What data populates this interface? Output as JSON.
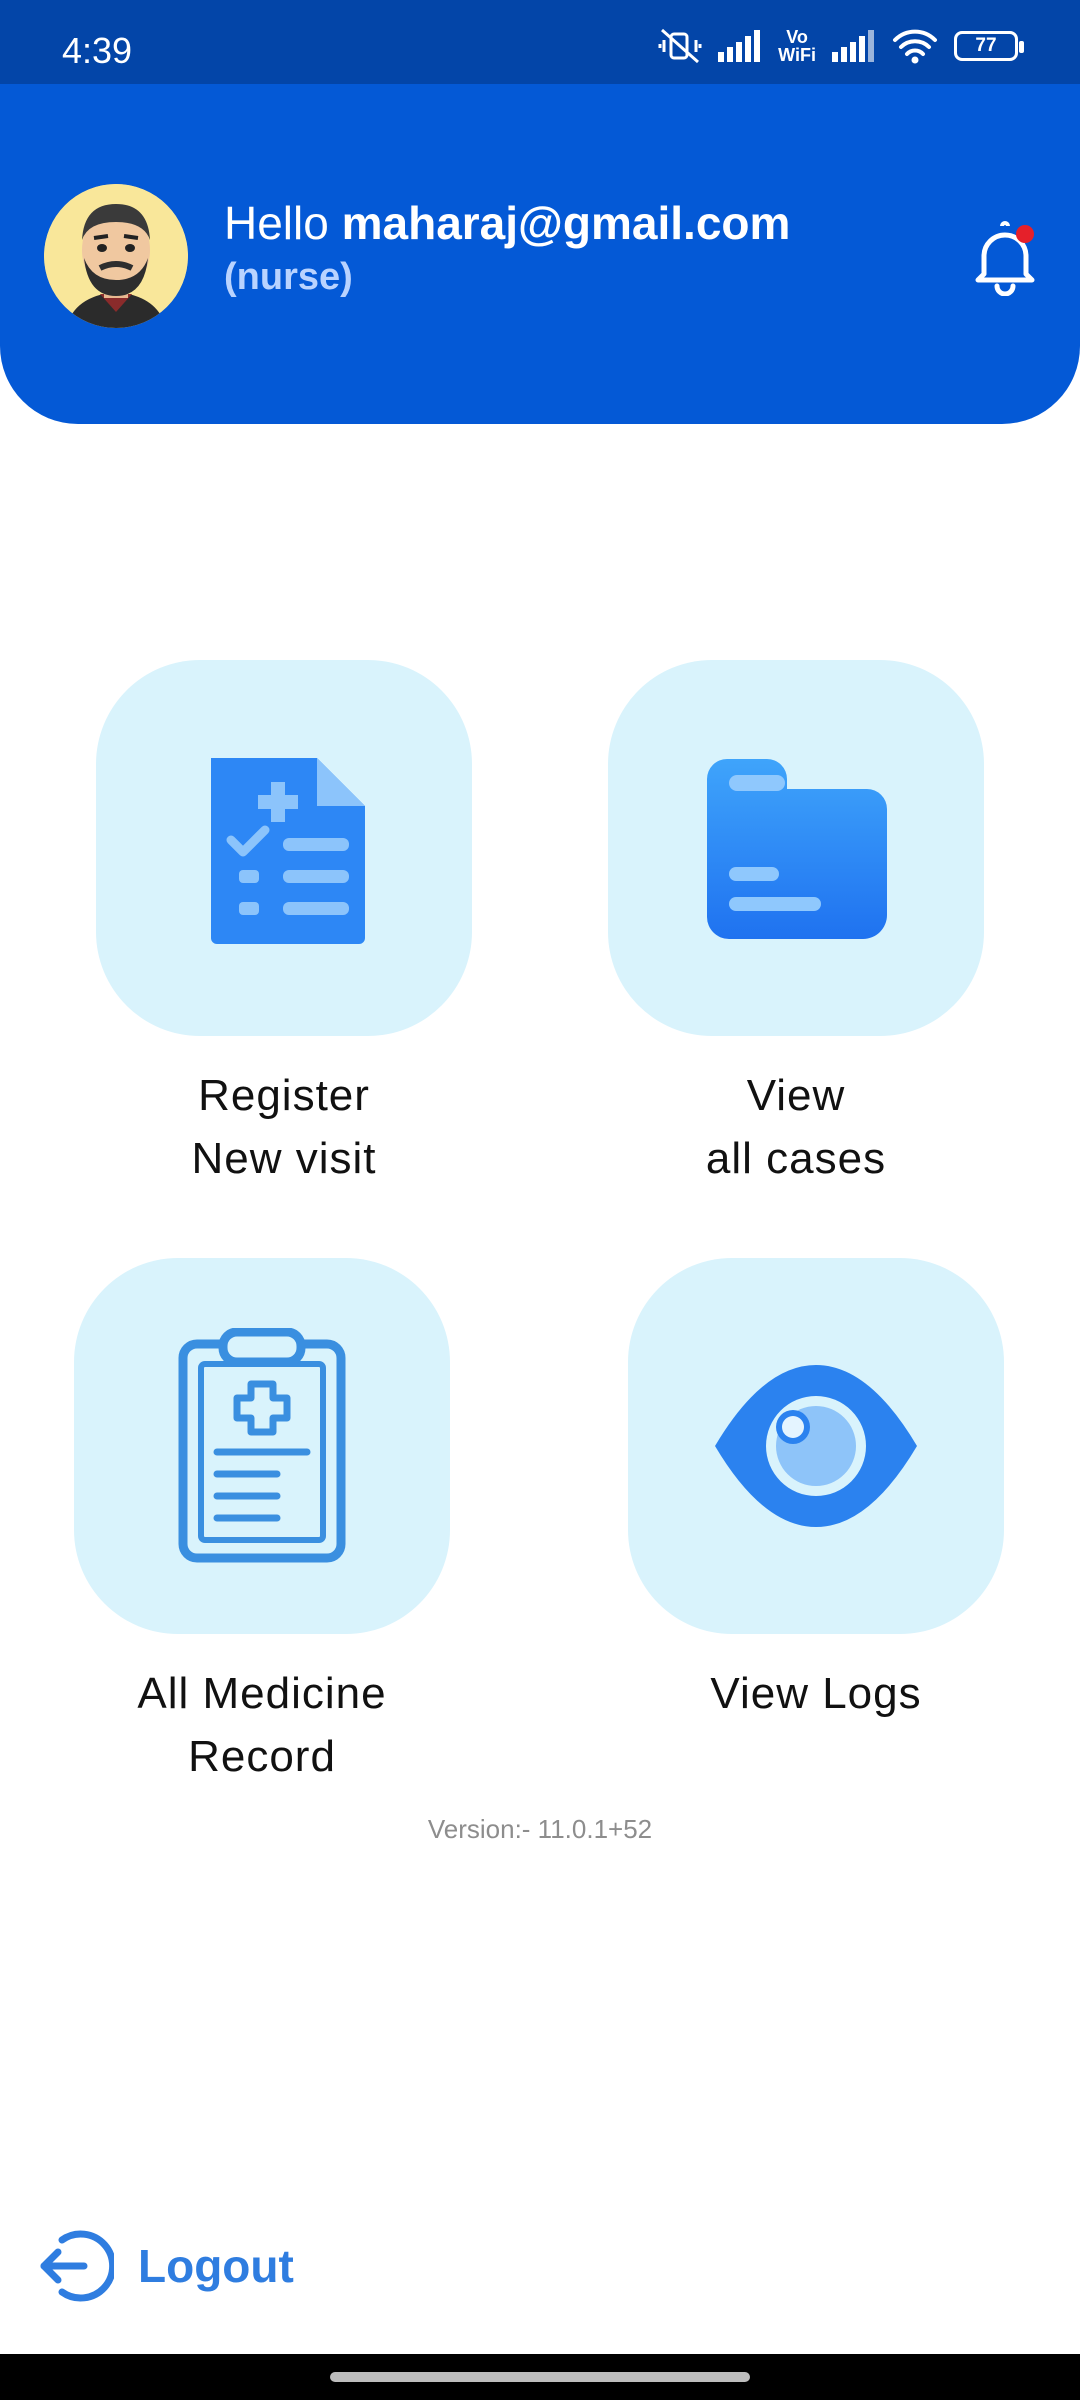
{
  "status_bar": {
    "time": "4:39",
    "vowifi_top": "Vo",
    "vowifi_bottom": "WiFi",
    "battery": "77",
    "icons": [
      "mute-vibrate-icon",
      "signal-icon",
      "vowifi-icon",
      "signal-icon",
      "wifi-icon",
      "battery-icon"
    ]
  },
  "header": {
    "greeting_prefix": "Hello ",
    "email": "maharaj@gmail.com",
    "role": "(nurse)",
    "avatar_icon": "user-avatar",
    "notification_icon": "bell-icon",
    "notification_dot_color": "#e5202a"
  },
  "tiles": [
    {
      "line1": "Register",
      "line2": "New visit",
      "icon": "medical-report-icon"
    },
    {
      "line1": "View",
      "line2": "all cases",
      "icon": "folder-icon"
    },
    {
      "line1": "All Medicine",
      "line2": "Record",
      "icon": "clipboard-medical-icon"
    },
    {
      "line1": "View Logs",
      "line2": "",
      "icon": "eye-icon"
    }
  ],
  "version": "Version:-  11.0.1+52",
  "logout": {
    "label": "Logout",
    "icon": "logout-icon"
  },
  "colors": {
    "status_bar": "#0345a8",
    "header": "#0459d6",
    "tile_bg": "#d9f3fc",
    "accent": "#2f7de0"
  }
}
